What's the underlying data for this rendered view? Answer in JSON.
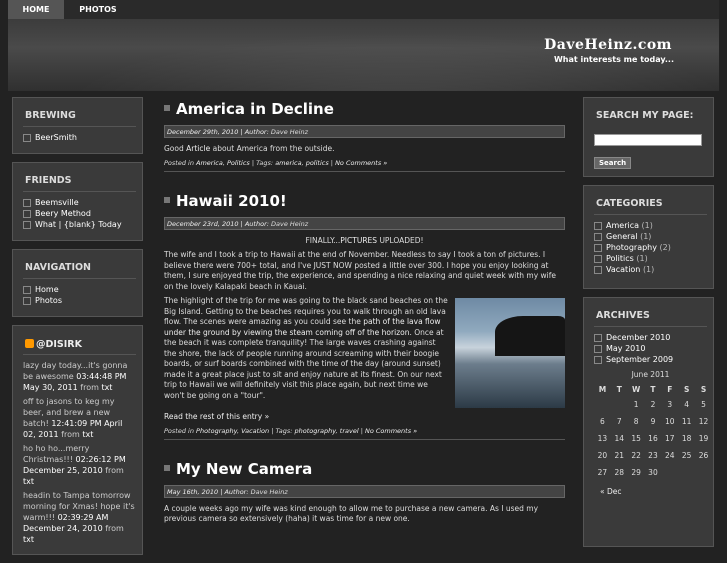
{
  "nav": {
    "home": "Home",
    "photos": "Photos"
  },
  "header": {
    "title": "DaveHeinz.com",
    "tagline": "What interests me today..."
  },
  "left": {
    "brewing": {
      "title": "Brewing",
      "items": [
        "BeerSmith"
      ]
    },
    "friends": {
      "title": "Friends",
      "items": [
        "Beemsville",
        "Beery Method",
        "What | {blank} Today"
      ]
    },
    "navigation": {
      "title": "Navigation",
      "items": [
        "Home",
        "Photos"
      ]
    },
    "twitter": {
      "title": "@DISIRK",
      "tweets": [
        {
          "text": "lazy day today...it's gonna be awesome",
          "time": "03:44:48 PM May 30, 2011",
          "from": "from",
          "src": "txt"
        },
        {
          "text": "off to jasons to keg my beer, and brew a new batch!",
          "time": "12:41:09 PM April 02, 2011",
          "from": "from",
          "src": "txt"
        },
        {
          "text": "ho ho ho...merry Christmas!!!",
          "time": "02:26:12 PM December 25, 2010",
          "from": "from",
          "src": "txt"
        },
        {
          "text": "headin to Tampa tomorrow morning for Xmas! hope it's warm!!!",
          "time": "02:39:29 AM December 24, 2010",
          "from": "from",
          "src": "txt"
        }
      ]
    }
  },
  "posts": [
    {
      "title": "America in Decline",
      "date": "December 29th, 2010",
      "author_label": "Author:",
      "author": "Dave Heinz",
      "body_pre": "Good",
      "body_link": "Article",
      "body_post": "about America from the outside.",
      "posted_in": "Posted in",
      "cats": [
        "America",
        "Politics"
      ],
      "tags_label": "Tags:",
      "tags": [
        "america",
        "politics"
      ],
      "comments": "No Comments »"
    },
    {
      "title": "Hawaii 2010!",
      "date": "December 23rd, 2010",
      "author_label": "Author:",
      "author": "Dave Heinz",
      "line1_pre": "FINALLY...",
      "line1_link": "PICTURES",
      "line1_post": "UPLOADED!",
      "p1": "The wife and I took a trip to Hawaii at the end of November. Needless to say I took a ton of pictures. I believe there were 700+ total, and I've JUST NOW posted a little over 300. I hope you enjoy looking at them, I sure enjoyed the trip, the experience, and spending a nice relaxing and quiet week with my wife on the lovely Kalapaki beach in Kauai.",
      "p2_pre": "The highlight of the trip for me was going to the black sand beaches on the Big Island. Getting to the beaches requires you to walk through an old lava flow. The scenes were amazing as you could see the",
      "p2_link": "path of the lava flow under the ground by viewing the steam coming off of the horizon",
      "p2_post": ". Once at the beach it was complete tranquility! The large waves crashing against the shore, the lack of people running around screaming with their boogie boards, or surf boards combined with the time of the day (around sunset) made it a great place just to sit and enjoy nature at its finest. On our next trip to Hawaii we will definitely visit this place again, but next time we won't be going on a \"tour\".",
      "more": "Read the rest of this entry »",
      "posted_in": "Posted in",
      "cats": [
        "Photography",
        "Vacation"
      ],
      "tags_label": "Tags:",
      "tags": [
        "photography",
        "travel"
      ],
      "comments": "No Comments »"
    },
    {
      "title": "My New Camera",
      "date": "May 16th, 2010",
      "author_label": "Author:",
      "author": "Dave Heinz",
      "p1": "A couple weeks ago my wife was kind enough to allow me to purchase a new camera. As I used my previous camera so extensively (haha) it was time for a new one."
    }
  ],
  "right": {
    "search": {
      "title": "Search My Page:",
      "button": "Search"
    },
    "categories": {
      "title": "Categories",
      "items": [
        {
          "name": "America",
          "count": "(1)"
        },
        {
          "name": "General",
          "count": "(1)"
        },
        {
          "name": "Photography",
          "count": "(2)"
        },
        {
          "name": "Politics",
          "count": "(1)"
        },
        {
          "name": "Vacation",
          "count": "(1)"
        }
      ]
    },
    "archives": {
      "title": "Archives",
      "items": [
        "December 2010",
        "May 2010",
        "September 2009"
      ]
    },
    "calendar": {
      "caption": "June 2011",
      "days": [
        "M",
        "T",
        "W",
        "T",
        "F",
        "S",
        "S"
      ],
      "weeks": [
        [
          "",
          "",
          "1",
          "2",
          "3",
          "4",
          "5"
        ],
        [
          "6",
          "7",
          "8",
          "9",
          "10",
          "11",
          "12"
        ],
        [
          "13",
          "14",
          "15",
          "16",
          "17",
          "18",
          "19"
        ],
        [
          "20",
          "21",
          "22",
          "23",
          "24",
          "25",
          "26"
        ],
        [
          "27",
          "28",
          "29",
          "30",
          "",
          "",
          ""
        ]
      ],
      "prev": "« Dec"
    }
  }
}
